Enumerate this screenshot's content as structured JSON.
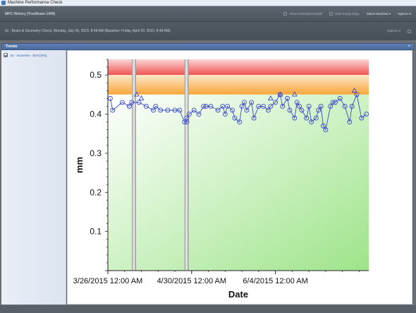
{
  "window": {
    "title": "Machine Performance Check"
  },
  "history_bar": {
    "title": "MPC History (TrueBeam 1449)",
    "buttons": [
      {
        "label": "Show Extended Details",
        "icon": "details-icon"
      },
      {
        "label": "Hide Empty Days",
        "icon": "filter-icon"
      },
      {
        "label": "Select Machine ▾",
        "icon": ""
      },
      {
        "label": "Options ▾",
        "icon": ""
      }
    ]
  },
  "check_bar": {
    "title": "6x : Beam & Geometry Check, Monday, July 06, 2015, 8:48 AM (Baseline: Friday, April 10, 2015, 8:49 AM)",
    "options_label": "Options ▾"
  },
  "trends": {
    "title": "Trends",
    "close_glyph": "×"
  },
  "sidebar": {
    "series": [
      {
        "label": "6x - Isocenter - Size [mm]",
        "checked": true
      }
    ]
  },
  "colors": {
    "series": "#3b47c6",
    "band_red": "#f05454",
    "band_orange": "#f7a63a",
    "band_green": "#9ee48a"
  },
  "chart_data": {
    "type": "line",
    "ylabel": "mm",
    "xlabel": "Date",
    "xlim": [
      "2015-03-26",
      "2015-07-13"
    ],
    "ylim": [
      0,
      0.54
    ],
    "yticks": [
      0.1,
      0.2,
      0.3,
      0.4,
      0.5
    ],
    "ytick_labels": [
      "0.1",
      "0.2",
      "0.3",
      "0.4",
      "0.5"
    ],
    "xticks": [
      "2015-03-26",
      "2015-04-30",
      "2015-06-04"
    ],
    "xtick_labels": [
      "3/26/2015 12:00 AM",
      "4/30/2015 12:00 AM",
      "6/4/2015 12:00 AM"
    ],
    "bands": [
      {
        "level": "fail",
        "from": 0.5,
        "to": 0.55
      },
      {
        "level": "warning",
        "from": 0.45,
        "to": 0.5
      },
      {
        "level": "pass",
        "from": 0,
        "to": 0.45
      }
    ],
    "gaps": [
      {
        "from": "2015-04-05",
        "to": "2015-04-06"
      },
      {
        "from": "2015-04-27",
        "to": "2015-04-28"
      }
    ],
    "series": [
      {
        "marker": "circle",
        "x": [
          "2015-03-27",
          "2015-03-28",
          "2015-04-01",
          "2015-04-04",
          "2015-04-04",
          "2015-04-05",
          "2015-04-08",
          "2015-04-11",
          "2015-04-14",
          "2015-04-15",
          "2015-04-17",
          "2015-04-20",
          "2015-04-23",
          "2015-04-25",
          "2015-04-27",
          "2015-04-28",
          "2015-04-28",
          "2015-04-29",
          "2015-05-01",
          "2015-05-03",
          "2015-05-05",
          "2015-05-06",
          "2015-05-08",
          "2015-05-11",
          "2015-05-13",
          "2015-05-14",
          "2015-05-15",
          "2015-05-17",
          "2015-05-18",
          "2015-05-20",
          "2015-05-21",
          "2015-05-22",
          "2015-05-23",
          "2015-05-25",
          "2015-05-26",
          "2015-05-28",
          "2015-05-30",
          "2015-06-01",
          "2015-06-02",
          "2015-06-04",
          "2015-06-06",
          "2015-06-07",
          "2015-06-09",
          "2015-06-10",
          "2015-06-12",
          "2015-06-13",
          "2015-06-14",
          "2015-06-15",
          "2015-06-17",
          "2015-06-18",
          "2015-06-19",
          "2015-06-21",
          "2015-06-22",
          "2015-06-23",
          "2015-06-24",
          "2015-06-25",
          "2015-06-27",
          "2015-06-28",
          "2015-06-29",
          "2015-07-01",
          "2015-07-03",
          "2015-07-05",
          "2015-07-06",
          "2015-07-08",
          "2015-07-10",
          "2015-07-12"
        ],
        "y": [
          0.44,
          0.41,
          0.43,
          0.42,
          0.42,
          0.43,
          0.43,
          0.42,
          0.41,
          0.42,
          0.41,
          0.41,
          0.41,
          0.41,
          0.38,
          0.38,
          0.39,
          0.4,
          0.41,
          0.4,
          0.42,
          0.42,
          0.42,
          0.41,
          0.42,
          0.4,
          0.42,
          0.41,
          0.39,
          0.38,
          0.42,
          0.43,
          0.41,
          0.43,
          0.39,
          0.42,
          0.42,
          0.41,
          0.42,
          0.43,
          0.45,
          0.42,
          0.44,
          0.41,
          0.39,
          0.43,
          0.42,
          0.41,
          0.39,
          0.42,
          0.38,
          0.39,
          0.41,
          0.42,
          0.37,
          0.36,
          0.42,
          0.43,
          0.43,
          0.44,
          0.42,
          0.38,
          0.42,
          0.45,
          0.39,
          0.4
        ]
      },
      {
        "marker": "triangle",
        "x": [
          "2015-04-07",
          "2015-04-09",
          "2015-06-02",
          "2015-06-06",
          "2015-06-12",
          "2015-07-07"
        ],
        "y": [
          0.45,
          0.44,
          0.44,
          0.45,
          0.45,
          0.46
        ]
      }
    ]
  }
}
